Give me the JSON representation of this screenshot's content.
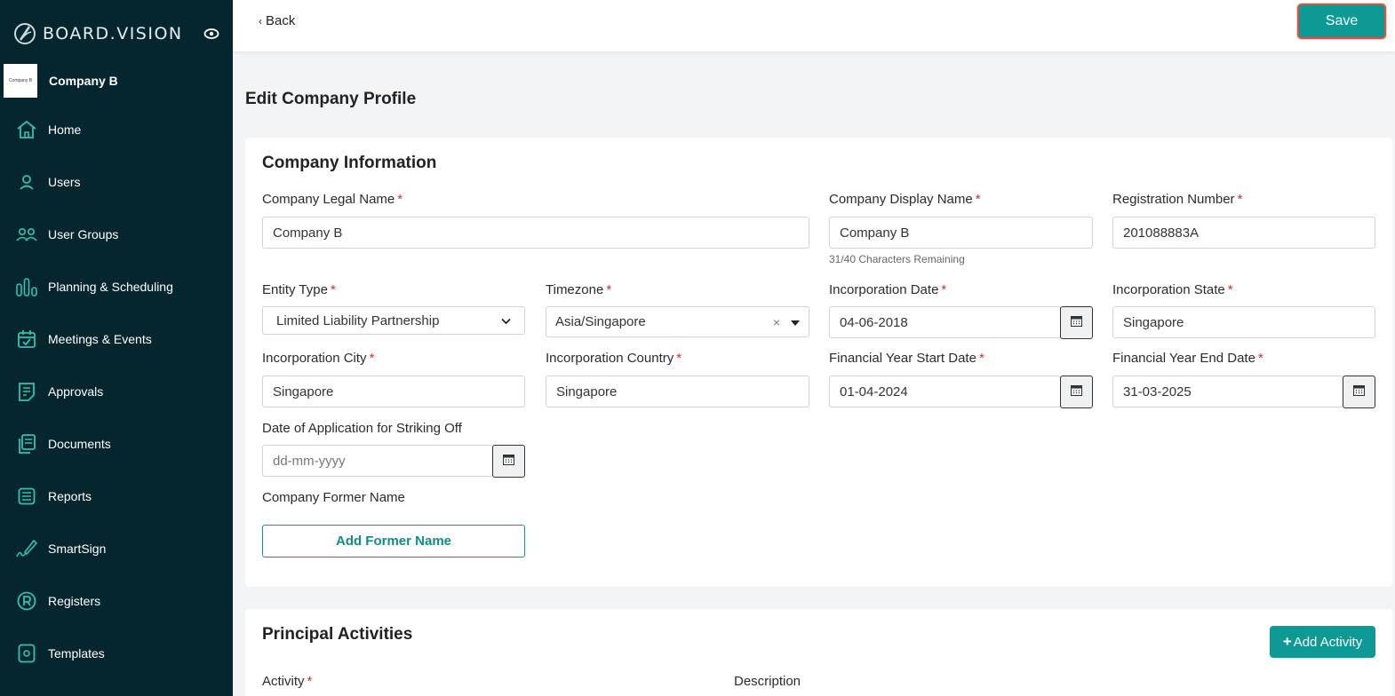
{
  "brand": {
    "name": "BOARD.VISION"
  },
  "company": {
    "name": "Company B",
    "logo_text": "Company B"
  },
  "sidebar": {
    "items": [
      {
        "label": "Home",
        "icon": "home-icon"
      },
      {
        "label": "Users",
        "icon": "user-icon"
      },
      {
        "label": "User Groups",
        "icon": "user-groups-icon"
      },
      {
        "label": "Planning & Scheduling",
        "icon": "planning-icon"
      },
      {
        "label": "Meetings & Events",
        "icon": "calendar-check-icon"
      },
      {
        "label": "Approvals",
        "icon": "approvals-icon"
      },
      {
        "label": "Documents",
        "icon": "documents-icon"
      },
      {
        "label": "Reports",
        "icon": "reports-icon"
      },
      {
        "label": "SmartSign",
        "icon": "pen-icon"
      },
      {
        "label": "Registers",
        "icon": "registered-icon"
      },
      {
        "label": "Templates",
        "icon": "templates-icon"
      }
    ]
  },
  "topbar": {
    "back_label": "Back",
    "save_label": "Save"
  },
  "page": {
    "title": "Edit Company Profile"
  },
  "company_info": {
    "title": "Company Information",
    "legal_name": {
      "label": "Company Legal Name",
      "value": "Company B"
    },
    "display_name": {
      "label": "Company Display Name",
      "value": "Company B",
      "hint": "31/40 Characters Remaining"
    },
    "registration_number": {
      "label": "Registration Number",
      "value": "201088883A"
    },
    "entity_type": {
      "label": "Entity Type",
      "value": "Limited Liability Partnership"
    },
    "timezone": {
      "label": "Timezone",
      "value": "Asia/Singapore"
    },
    "incorporation_date": {
      "label": "Incorporation Date",
      "value": "04-06-2018"
    },
    "incorporation_state": {
      "label": "Incorporation State",
      "value": "Singapore"
    },
    "incorporation_city": {
      "label": "Incorporation City",
      "value": "Singapore"
    },
    "incorporation_country": {
      "label": "Incorporation Country",
      "value": "Singapore"
    },
    "fy_start": {
      "label": "Financial Year Start Date",
      "value": "01-04-2024"
    },
    "fy_end": {
      "label": "Financial Year End Date",
      "value": "31-03-2025"
    },
    "striking_off": {
      "label": "Date of Application for Striking Off",
      "placeholder": "dd-mm-yyyy"
    },
    "former_name": {
      "label": "Company Former Name",
      "button": "Add Former Name"
    }
  },
  "principal_activities": {
    "title": "Principal Activities",
    "add_button": "Add Activity",
    "activity_label": "Activity",
    "description_label": "Description"
  },
  "colors": {
    "sidebar_bg": "#06262f",
    "accent": "#0f9995",
    "required": "#d32f2f",
    "nav_icon": "#2fc4b2"
  }
}
